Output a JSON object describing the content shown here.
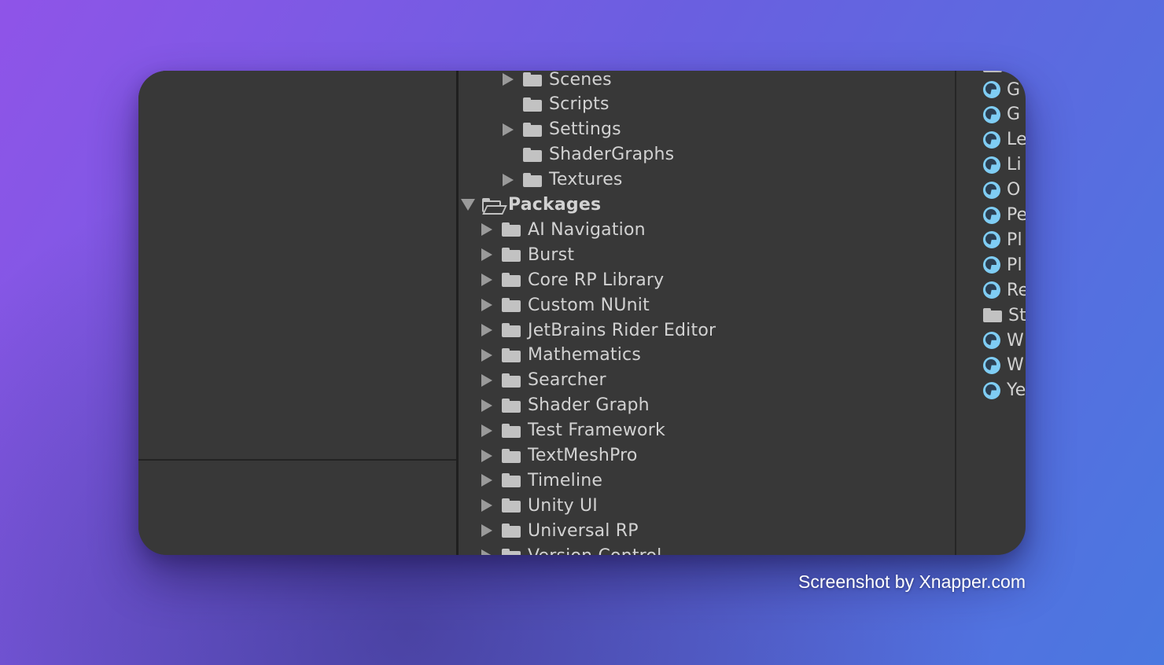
{
  "project_tree": {
    "rows": [
      {
        "label": "Scenes",
        "arrow": "collapsed",
        "folder": "closed"
      },
      {
        "label": "Scripts",
        "arrow": "none",
        "folder": "closed"
      },
      {
        "label": "Settings",
        "arrow": "collapsed",
        "folder": "closed"
      },
      {
        "label": "ShaderGraphs",
        "arrow": "none",
        "folder": "closed"
      },
      {
        "label": "Textures",
        "arrow": "collapsed",
        "folder": "closed"
      },
      {
        "label": "Packages",
        "arrow": "expanded",
        "folder": "open"
      },
      {
        "label": "AI Navigation",
        "arrow": "collapsed",
        "folder": "closed"
      },
      {
        "label": "Burst",
        "arrow": "collapsed",
        "folder": "closed"
      },
      {
        "label": "Core RP Library",
        "arrow": "collapsed",
        "folder": "closed"
      },
      {
        "label": "Custom NUnit",
        "arrow": "collapsed",
        "folder": "closed"
      },
      {
        "label": "JetBrains Rider Editor",
        "arrow": "collapsed",
        "folder": "closed"
      },
      {
        "label": "Mathematics",
        "arrow": "collapsed",
        "folder": "closed"
      },
      {
        "label": "Searcher",
        "arrow": "collapsed",
        "folder": "closed"
      },
      {
        "label": "Shader Graph",
        "arrow": "collapsed",
        "folder": "closed"
      },
      {
        "label": "Test Framework",
        "arrow": "collapsed",
        "folder": "closed"
      },
      {
        "label": "TextMeshPro",
        "arrow": "collapsed",
        "folder": "closed"
      },
      {
        "label": "Timeline",
        "arrow": "collapsed",
        "folder": "closed"
      },
      {
        "label": "Unity UI",
        "arrow": "collapsed",
        "folder": "closed"
      },
      {
        "label": "Universal RP",
        "arrow": "collapsed",
        "folder": "closed"
      },
      {
        "label": "Version Control",
        "arrow": "collapsed",
        "folder": "closed"
      }
    ]
  },
  "asset_list": {
    "items": [
      {
        "label": "G",
        "icon": "material-sphere-icon"
      },
      {
        "label": "G",
        "icon": "material-sphere-icon"
      },
      {
        "label": "Le",
        "icon": "material-sphere-icon"
      },
      {
        "label": "Li",
        "icon": "material-sphere-icon"
      },
      {
        "label": "O",
        "icon": "material-sphere-icon"
      },
      {
        "label": "Pe",
        "icon": "material-sphere-icon"
      },
      {
        "label": "Pl",
        "icon": "material-sphere-icon"
      },
      {
        "label": "Pl",
        "icon": "material-sphere-icon"
      },
      {
        "label": "Re",
        "icon": "material-sphere-icon"
      },
      {
        "label": "St",
        "icon": "folder-icon"
      },
      {
        "label": "W",
        "icon": "material-sphere-icon"
      },
      {
        "label": "W",
        "icon": "material-sphere-icon"
      },
      {
        "label": "Ye",
        "icon": "material-sphere-icon"
      }
    ]
  },
  "watermark": {
    "text": "Screenshot by Xnapper.com"
  },
  "colors": {
    "panel_bg": "#383838",
    "text": "#d2d2d2",
    "icon_gray": "#c2c2c2",
    "material_blue": "#7fcdf4"
  }
}
